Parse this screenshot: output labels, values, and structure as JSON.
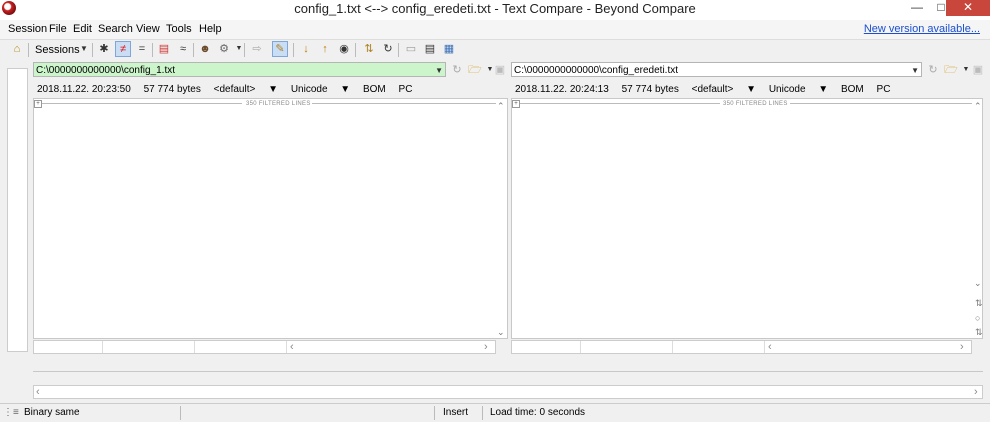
{
  "window": {
    "title": "config_1.txt <--> config_eredeti.txt - Text Compare - Beyond Compare"
  },
  "menu": [
    "Session",
    "File",
    "Edit",
    "Search",
    "View",
    "Tools",
    "Help"
  ],
  "new_version": "New version available...",
  "toolbar": {
    "sessions_label": "Sessions"
  },
  "left": {
    "path": "C:\\0000000000000\\config_1.txt",
    "timestamp": "2018.11.22. 20:23:50",
    "size": "57 774 bytes",
    "format": "<default>",
    "encoding": "Unicode",
    "bom": "BOM",
    "line_ending": "PC",
    "filtered": "350 FILTERED LINES"
  },
  "right": {
    "path": "C:\\0000000000000\\config_eredeti.txt",
    "timestamp": "2018.11.22. 20:24:13",
    "size": "57 774 bytes",
    "format": "<default>",
    "encoding": "Unicode",
    "bom": "BOM",
    "line_ending": "PC",
    "filtered": "350 FILTERED LINES"
  },
  "status": {
    "compare_result": "Binary same",
    "mode": "Insert",
    "load_time": "Load time: 0 seconds"
  }
}
